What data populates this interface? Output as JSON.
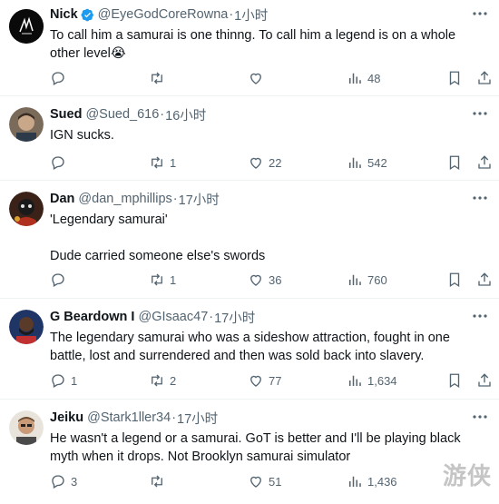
{
  "tweets": [
    {
      "name": "Nick",
      "verified": true,
      "handle": "@EyeGodCoreRowna",
      "sep": "·",
      "time": "1小时",
      "text": "To call him a samurai is one thinng. To call him a legend is on a whole other level😭",
      "reply": "",
      "retweet": "",
      "like": "",
      "views": "48"
    },
    {
      "name": "Sued",
      "verified": false,
      "handle": "@Sued_616",
      "sep": "·",
      "time": "16小时",
      "text": "IGN sucks.",
      "reply": "",
      "retweet": "1",
      "like": "22",
      "views": "542"
    },
    {
      "name": "Dan",
      "verified": false,
      "handle": "@dan_mphillips",
      "sep": "·",
      "time": "17小时",
      "text": "'Legendary samurai'\n\nDude carried someone else's swords",
      "reply": "",
      "retweet": "1",
      "like": "36",
      "views": "760"
    },
    {
      "name": "G Beardown I",
      "verified": false,
      "handle": "@GIsaac47",
      "sep": "·",
      "time": "17小时",
      "text": "The legendary samurai who was a sideshow attraction, fought in one battle, lost and surrendered and then was sold back into slavery.",
      "reply": "1",
      "retweet": "2",
      "like": "77",
      "views": "1,634"
    },
    {
      "name": "Jeiku",
      "verified": false,
      "handle": "@Stark1ller34",
      "sep": "·",
      "time": "17小时",
      "text": "He wasn't a legend or a samurai. GoT is better and I'll be playing black myth when it drops. Not Brooklyn samurai simulator",
      "reply": "3",
      "retweet": "",
      "like": "51",
      "views": "1,436"
    }
  ],
  "watermark": "游侠",
  "colors": {
    "text": "#0f1419",
    "muted": "#536471",
    "verified": "#1d9bf0",
    "divider": "#eff3f4"
  }
}
